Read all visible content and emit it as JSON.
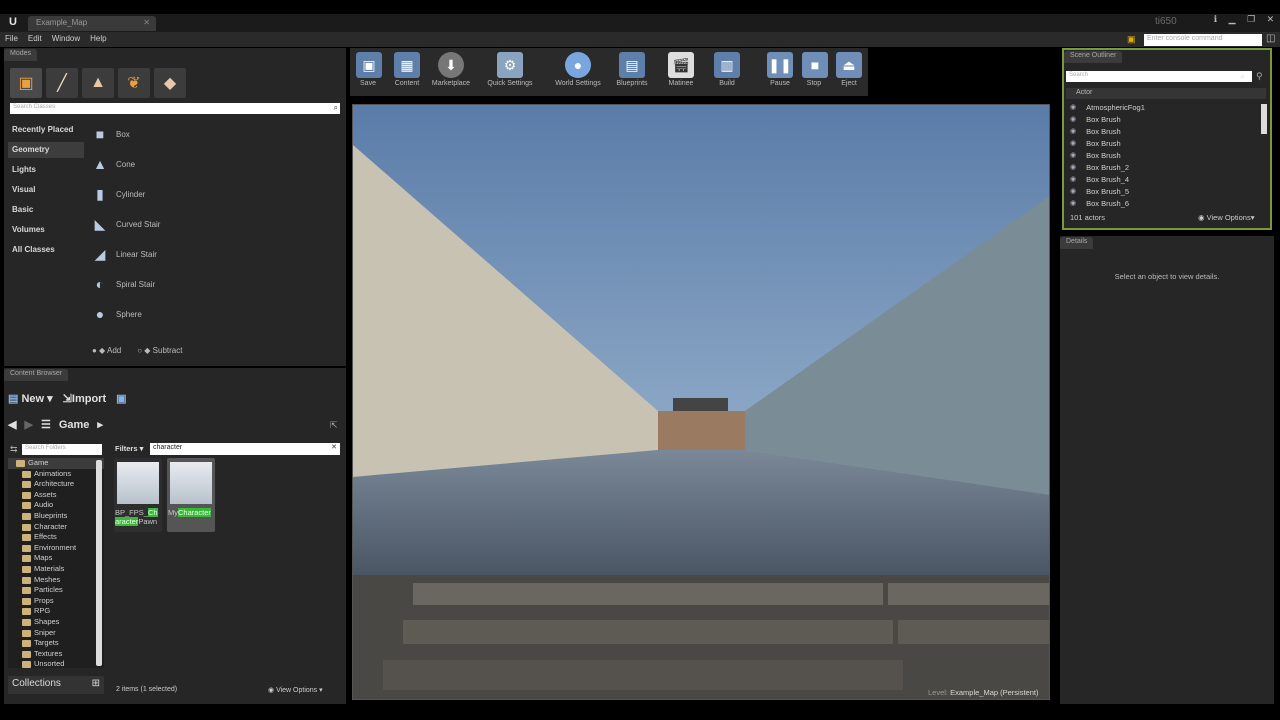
{
  "title_tab": "Example_Map",
  "window_brand": "ti650",
  "menu": [
    "File",
    "Edit",
    "Window",
    "Help"
  ],
  "console_placeholder": "Enter console command",
  "modes": {
    "tab": "Modes",
    "search_placeholder": "Search Classes",
    "categories": [
      "Recently Placed",
      "Geometry",
      "Lights",
      "Visual",
      "Basic",
      "Volumes",
      "All Classes"
    ],
    "selected_category": "Geometry",
    "items": [
      "Box",
      "Cone",
      "Cylinder",
      "Curved Stair",
      "Linear Stair",
      "Spiral Stair",
      "Sphere"
    ],
    "add": "Add",
    "subtract": "Subtract"
  },
  "content_browser": {
    "tab": "Content Browser",
    "new": "New",
    "import": "Import",
    "path": "Game",
    "folder_search": "Search Folders",
    "root_folder": "Game",
    "folders": [
      "Animations",
      "Architecture",
      "Assets",
      "Audio",
      "Blueprints",
      "Character",
      "Effects",
      "Environment",
      "Maps",
      "Materials",
      "Meshes",
      "Particles",
      "Props",
      "RPG",
      "Shapes",
      "Sniper",
      "Targets",
      "Textures",
      "Unsorted"
    ],
    "filters": "Filters",
    "filter_text": "character",
    "assets": [
      {
        "pre": "BP_FPS_",
        "hl": "Character",
        "post": "Pawn"
      },
      {
        "pre": "My",
        "hl": "Character",
        "post": ""
      }
    ],
    "status": "2 items (1 selected)",
    "view_options": "View Options",
    "collections": "Collections"
  },
  "toolbar": [
    "Save",
    "Content",
    "Marketplace",
    "Quick Settings",
    "World Settings",
    "Blueprints",
    "Matinee",
    "Build",
    "Pause",
    "Stop",
    "Eject"
  ],
  "viewport": {
    "level_label": "Level:",
    "level_name": "Example_Map (Persistent)"
  },
  "outliner": {
    "tab": "Scene Outliner",
    "search_placeholder": "Search",
    "column": "Actor",
    "rows": [
      "AtmosphericFog1",
      "Box Brush",
      "Box Brush",
      "Box Brush",
      "Box Brush",
      "Box Brush_2",
      "Box Brush_4",
      "Box Brush_5",
      "Box Brush_6"
    ],
    "count": "101 actors",
    "view_options": "View Options"
  },
  "details": {
    "tab": "Details",
    "message": "Select an object to view details."
  },
  "colors": {
    "accent": "#7a9a3a",
    "highlight": "#39b83a",
    "sky": "#8fb3d9"
  }
}
